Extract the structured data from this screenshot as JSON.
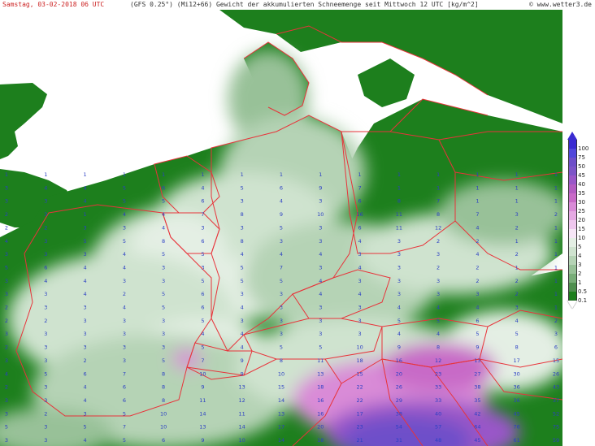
{
  "header": {
    "datetime": "Samstag, 03-02-2018 06 UTC",
    "model": "(GFS 0.25°) (Mi12+66)",
    "title": "Gewicht der akkumulierten Schneemenge seit Mittwoch 12 UTC [kg/m^2]",
    "source": "© www.wetter3.de"
  },
  "colors": {
    "sea": "#ffffff",
    "land_none": "#1d7f1d",
    "border_line": "#e8333a",
    "title_date": "#cc2222",
    "number_text": "#2b3fc4"
  },
  "legend": {
    "labels": [
      "100",
      "75",
      "50",
      "45",
      "40",
      "35",
      "30",
      "25",
      "20",
      "15",
      "10",
      "5",
      "4",
      "3",
      "2",
      "1",
      "0.5",
      "0.1"
    ],
    "colors": [
      "#3a2bd1",
      "#5147db",
      "#6e4fc9",
      "#7d55c8",
      "#9957c8",
      "#b35cc2",
      "#c86ac7",
      "#d98bd7",
      "#e5a9e3",
      "#efc7ee",
      "#f6e6f6",
      "#e4efe4",
      "#cfe3cf",
      "#b5d3b5",
      "#98c198",
      "#78ad78",
      "#4f8f4f",
      "#1d7f1d"
    ]
  },
  "grid_rows": [
    {
      "label": "row-46",
      "values": "1 1 1 1 1 1 1 1 1 1 1 1 1 1 1"
    },
    {
      "label": "row-45",
      "values": "3 4 4 5 6 4 5 6 9 7 1 1 1 1 1"
    },
    {
      "label": "row-44",
      "values": "3 3 4 5 5 6 3 4 3 6 8 7 1 1 1"
    },
    {
      "label": "row-43",
      "values": "2 3 1 4 4 7 8 9 10 16 11 8 7 3 2"
    },
    {
      "label": "row-42",
      "values": "2 2 3 3 4 3 3 5 3 6 11 12 4 2 1"
    },
    {
      "label": "row-41",
      "values": "4 3 5 5 8 6 8 3 3 4 3 2 2 1 1"
    },
    {
      "label": "row-40",
      "values": "3 3 3 4 5 5 4 4 4 3 3 3 4 2 1"
    },
    {
      "label": "row-39",
      "values": "5 6 4 4 3 3 5 7 3 4 3 2 2 1 1"
    },
    {
      "label": "row-38",
      "values": "3 4 4 3 3 5 5 5 4 3 3 3 2 2 1"
    },
    {
      "label": "row-37",
      "values": "3 3 4 2 5 6 3 3 4 4 3 3 3 2 1"
    },
    {
      "label": "row-36",
      "values": "2 3 3 4 5 6 4 3 3 3 4 4 4 3 1"
    },
    {
      "label": "row-35",
      "values": "2 2 3 3 3 5 3 3 3 3 5 5 6 4 2"
    },
    {
      "label": "row-34",
      "values": "3 3 3 3 3 4 4 3 3 3 4 4 5 5 3"
    },
    {
      "label": "row-33",
      "values": "2 3 3 3 3 5 4 5 5 10 9 8 9 8 6"
    },
    {
      "label": "row-32",
      "values": "3 3 2 3 5 7 9 8 11 18 16 12 13 17 15"
    },
    {
      "label": "row-31",
      "values": "4 5 6 7 8 10 9 10 13 15 20 23 27 30 26"
    },
    {
      "label": "row-30",
      "values": "2 3 4 6 8 9 13 15 18 22 26 33 38 36 43"
    },
    {
      "label": "row-29",
      "values": "3 3 4 6 8 11 12 14 16 22 29 33 35 36 37"
    },
    {
      "label": "row-28",
      "values": "3 2 3 5 10 14 11 13 16 17 38 40 42 45 52"
    },
    {
      "label": "row-27",
      "values": "5 3 5 7 10 13 14 17 20 23 54 57 64 76 75"
    },
    {
      "label": "row-26",
      "values": "3 3 4 5 6 9 10 14 18 21 31 48 45 61 59"
    }
  ]
}
